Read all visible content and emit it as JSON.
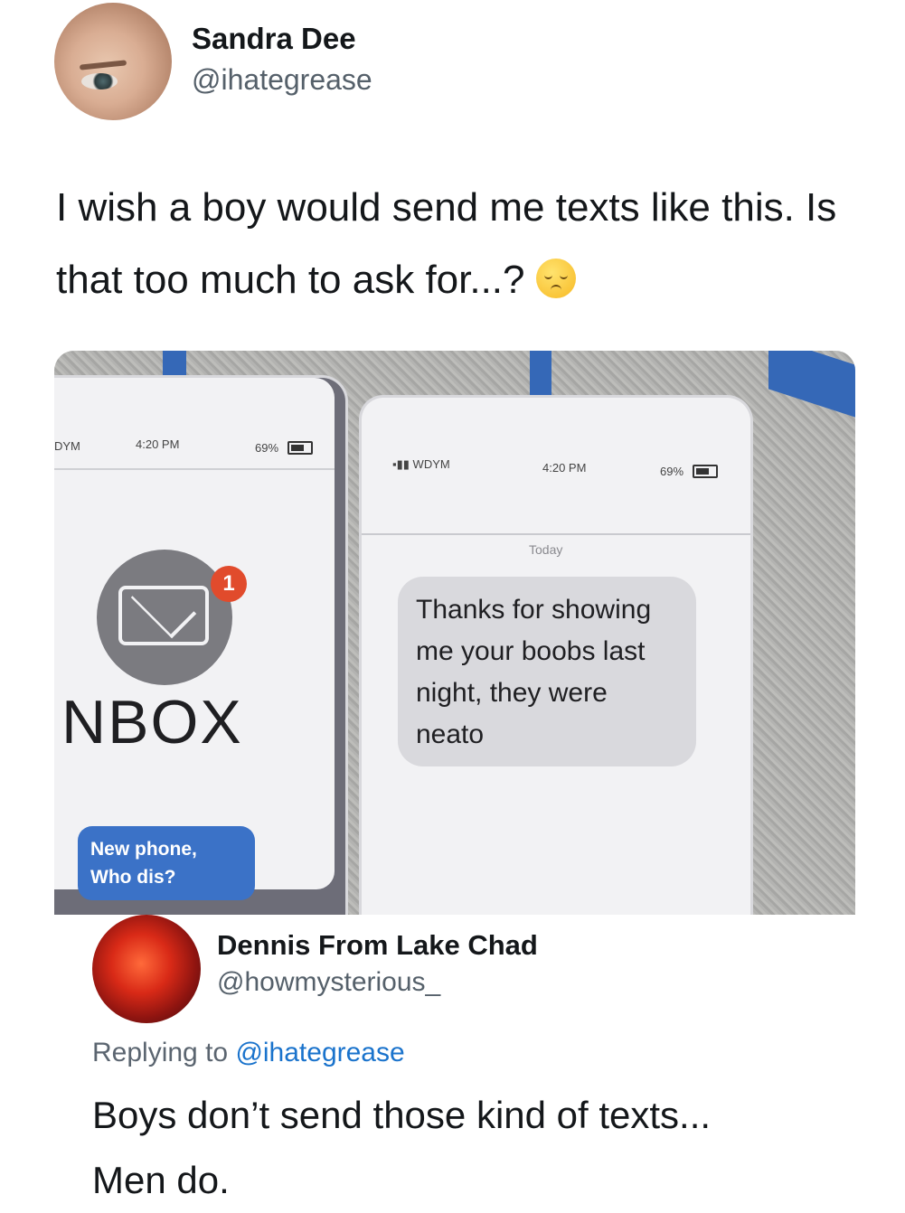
{
  "original_tweet": {
    "author_name": "Sandra Dee",
    "author_handle": "@ihategrease",
    "text": "I wish a boy would send me texts like this. Is that too much to ask for...?",
    "emoji": "pensive-face"
  },
  "photo": {
    "left_card": {
      "carrier": "DYM",
      "time": "4:20 PM",
      "battery": "69%",
      "badge_count": "1",
      "title": "NBOX",
      "bubble_text": "New phone, Who dis?"
    },
    "right_card": {
      "carrier": "WDYM",
      "time": "4:20 PM",
      "battery": "69%",
      "date_label": "Today",
      "message": "Thanks for showing me your boobs last night, they were neato"
    }
  },
  "reply_tweet": {
    "author_name": "Dennis From Lake Chad",
    "author_handle": "@howmysterious_",
    "replying_label": "Replying to",
    "replying_handle": "@ihategrease",
    "text_line1": "Boys don’t send those kind of texts...",
    "text_line2": "Men do."
  }
}
